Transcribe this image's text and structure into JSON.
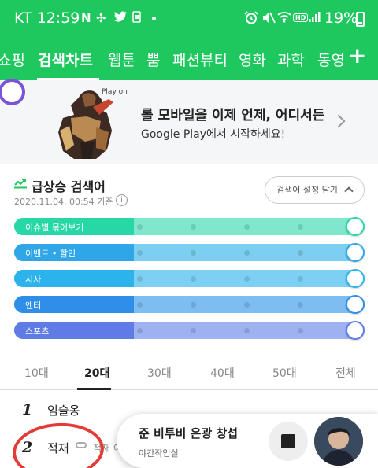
{
  "status": {
    "carrier_time": "KT 12:59",
    "battery_percent": "19%",
    "icons": [
      "n-icon",
      "extension-icon",
      "twitter-icon",
      "sim-icon",
      "alarm-icon",
      "mute-icon",
      "wifi-icon",
      "hd-icon",
      "signal-icon",
      "battery-icon"
    ]
  },
  "tabs": [
    {
      "label": "쇼핑"
    },
    {
      "label": "검색차트",
      "active": true
    },
    {
      "label": "웹툰"
    },
    {
      "label": "뿜"
    },
    {
      "label": "패션뷰티"
    },
    {
      "label": "영화"
    },
    {
      "label": "과학"
    },
    {
      "label": "동영"
    }
  ],
  "add_tab_label": "+",
  "ad": {
    "brand": "Play on",
    "title": "롤 모바일을 이제 언제, 어디서든",
    "subtitle": "Google Play에서 시작하세요!"
  },
  "section": {
    "title": "급상승 검색어",
    "date": "2020.11.04. 00:54 기준",
    "info_label": "i",
    "close_setting_label": "검색어 설정 닫기"
  },
  "sliders": [
    {
      "label": "이슈별 묶어보기",
      "color": "#27d7a6",
      "light": "#7ee7cc"
    },
    {
      "label": "이벤트 • 할인",
      "color": "#2ea6e8",
      "light": "#7ccff0"
    },
    {
      "label": "시사",
      "color": "#2cb3ec",
      "light": "#7dd0f3"
    },
    {
      "label": "엔터",
      "color": "#2f8ee8",
      "light": "#7dbdf2"
    },
    {
      "label": "스포츠",
      "color": "#5e7be6",
      "light": "#9eb1f1"
    }
  ],
  "age_tabs": [
    {
      "label": "10대"
    },
    {
      "label": "20대",
      "active": true
    },
    {
      "label": "30대"
    },
    {
      "label": "40대"
    },
    {
      "label": "50대"
    },
    {
      "label": "전체"
    }
  ],
  "ranks": [
    {
      "num": "1",
      "word": "임슬옹",
      "extra": ""
    },
    {
      "num": "2",
      "word": "적재",
      "extra": "적재 이"
    }
  ],
  "player": {
    "title": "준 비투비 은광 창섭",
    "subtitle": "야간작업실"
  }
}
